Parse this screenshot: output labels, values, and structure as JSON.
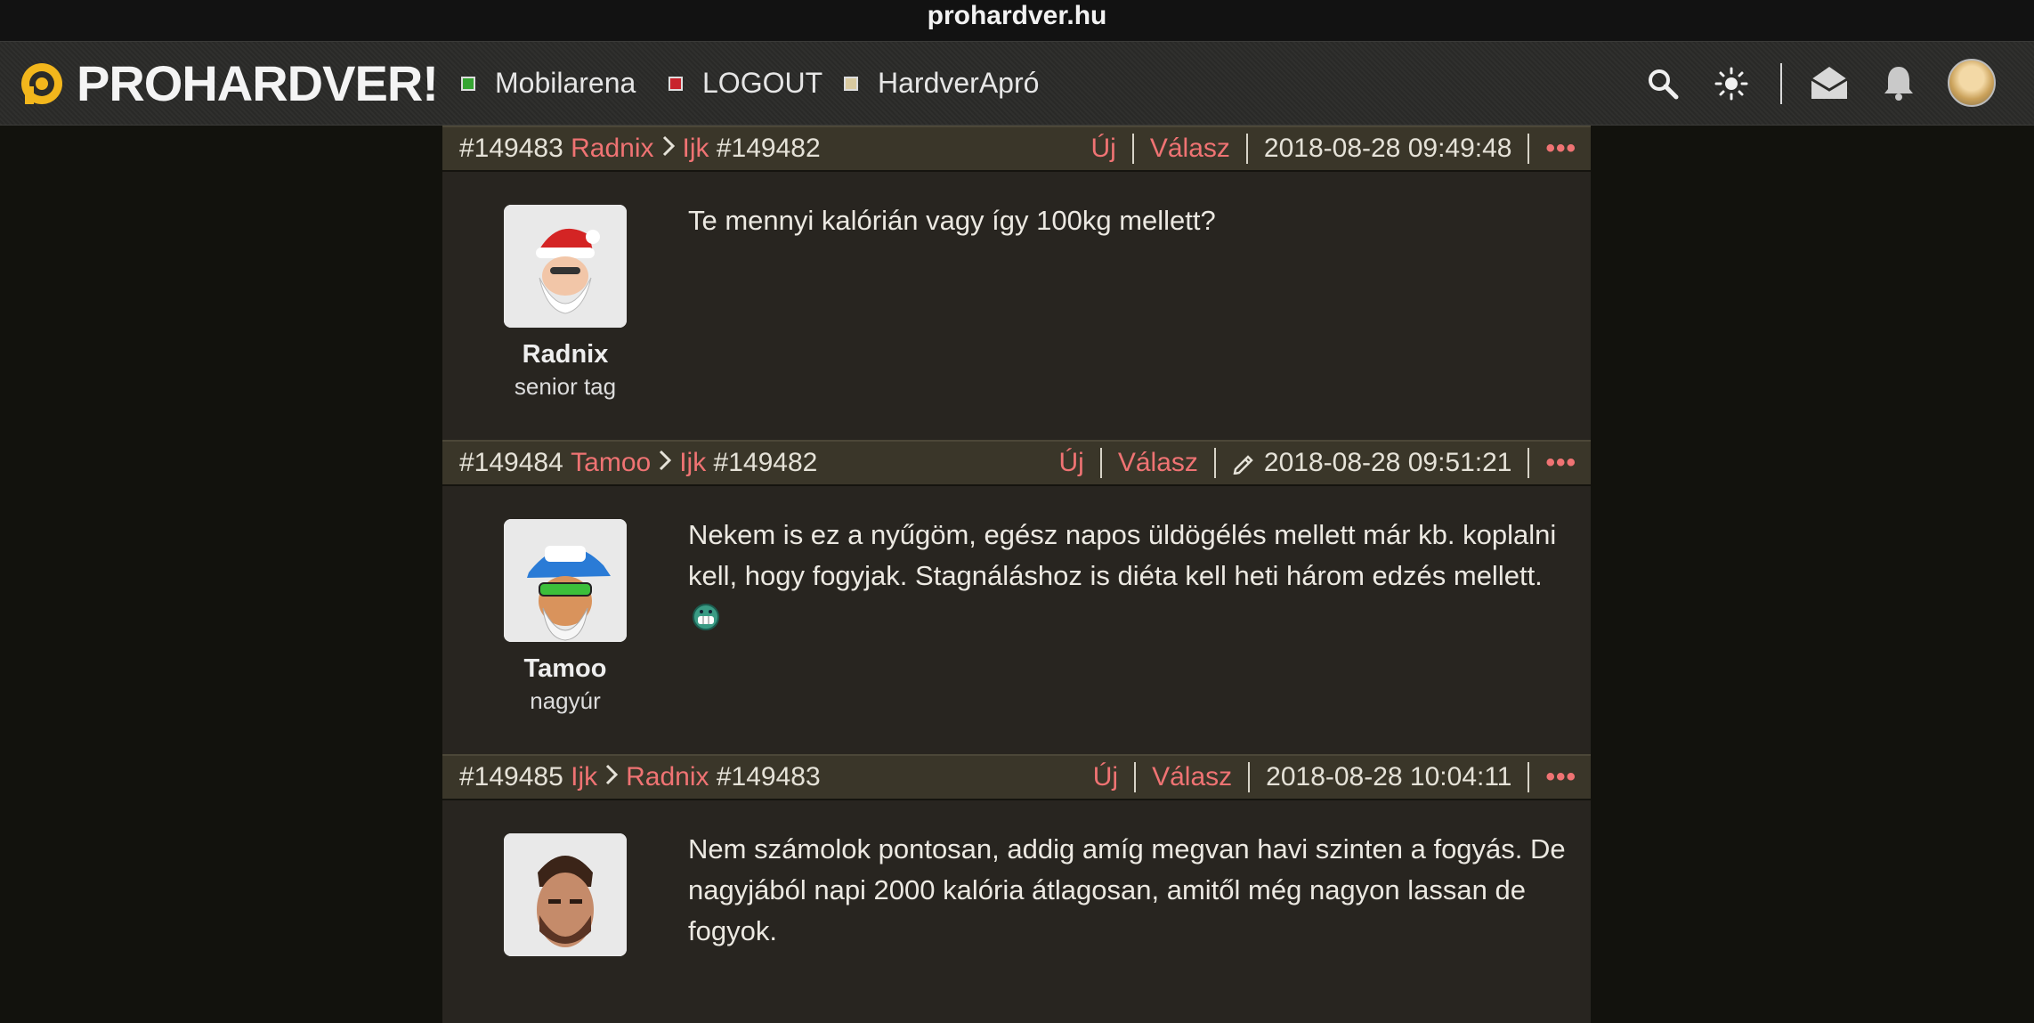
{
  "browser": {
    "url": "prohardver.hu"
  },
  "nav": {
    "logo_text": "PROHARDVER!",
    "links": [
      {
        "label": "Mobilarena",
        "color": "#35a532"
      },
      {
        "label": "LOGOUT",
        "color": "#c8232c"
      },
      {
        "label": "HardverApró",
        "color": "#d9caa0"
      }
    ],
    "icons": [
      "search-icon",
      "sun-icon",
      "envelope-icon",
      "bell-icon",
      "user-avatar"
    ]
  },
  "posts": [
    {
      "id": "#149483",
      "author": "Radnix",
      "reply_to_user": "Ijk",
      "reply_to_id": "#149482",
      "new_label": "Új",
      "reply_label": "Válasz",
      "timestamp": "2018-08-28 09:49:48",
      "edited": false,
      "user_name": "Radnix",
      "user_rank": "senior tag",
      "text": "Te mennyi kalórián vagy így 100kg mellett?"
    },
    {
      "id": "#149484",
      "author": "Tamoo",
      "reply_to_user": "Ijk",
      "reply_to_id": "#149482",
      "new_label": "Új",
      "reply_label": "Válasz",
      "timestamp": "2018-08-28 09:51:21",
      "edited": true,
      "user_name": "Tamoo",
      "user_rank": "nagyúr",
      "text": "Nekem is ez a nyűgöm, egész napos üldögélés mellett már kb. koplalni kell, hogy fogyjak. Stagnáláshoz is diéta kell heti három edzés mellett."
    },
    {
      "id": "#149485",
      "author": "Ijk",
      "reply_to_user": "Radnix",
      "reply_to_id": "#149483",
      "new_label": "Új",
      "reply_label": "Válasz",
      "timestamp": "2018-08-28 10:04:11",
      "edited": false,
      "user_name": "",
      "user_rank": "",
      "text": "Nem számolok pontosan, addig amíg megvan havi szinten a fogyás. De nagyjából napi 2000 kalória átlagosan, amitől még nagyon lassan de fogyok."
    }
  ]
}
